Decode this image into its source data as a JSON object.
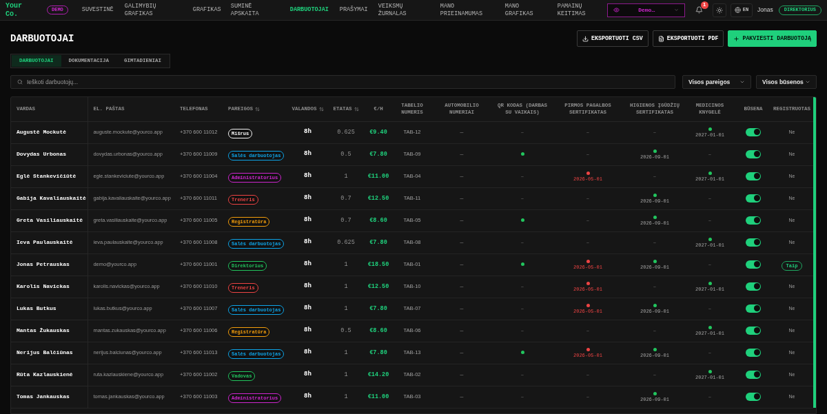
{
  "topbar": {
    "logo": "Your Co.",
    "env_badge": "DEMO",
    "nav": [
      {
        "label": "SUVESTINĖ",
        "selected": false
      },
      {
        "label": "GALIMYBIŲ GRAFIKAS",
        "selected": false
      },
      {
        "label": "GRAFIKAS",
        "selected": false
      },
      {
        "label": "SUMINĖ APSKAITA",
        "selected": false
      },
      {
        "label": "DARBUOTOJAI",
        "selected": true
      },
      {
        "label": "PRAŠYMAI",
        "selected": false
      },
      {
        "label": "VEIKSMŲ ŽURNALAS",
        "selected": false
      },
      {
        "label": "MANO PRIEINAMUMAS",
        "selected": false
      },
      {
        "label": "MANO GRAFIKAS",
        "selected": false
      },
      {
        "label": "PAMAINŲ KEITIMAS",
        "selected": false
      }
    ],
    "view_as": {
      "value": "Demo…"
    },
    "notifications": {
      "count": "1"
    },
    "language": "EN",
    "user": "Jonas",
    "role": "DIREKTORIUS"
  },
  "page": {
    "title": "DARBUOTOJAI",
    "actions": [
      {
        "kind": "download",
        "label": "EKSPORTUOTI CSV"
      },
      {
        "kind": "file",
        "label": "EKSPORTUOTI PDF"
      },
      {
        "kind": "primary",
        "label": "PAKVIESTI DARBUOTOJĄ"
      }
    ]
  },
  "tabs": [
    {
      "label": "DARBUOTOJAI",
      "selected": true
    },
    {
      "label": "DOKUMENTACIJA",
      "selected": false
    },
    {
      "label": "GIMTADIENIAI",
      "selected": false
    }
  ],
  "search": {
    "placeholder": "Ieškoti darbuotojų..."
  },
  "filters": [
    {
      "value": "Visos pareigos"
    },
    {
      "value": "Visos būsenos"
    }
  ],
  "table": {
    "columns": [
      {
        "label": "VARDAS",
        "sortable": false
      },
      {
        "label": "EL. PAŠTAS",
        "sortable": false
      },
      {
        "label": "TELEFONAS",
        "sortable": false
      },
      {
        "label": "PAREIGOS",
        "sortable": true
      },
      {
        "label": "VALANDOS",
        "sortable": true
      },
      {
        "label": "ETATAS",
        "sortable": true
      },
      {
        "label": "€/H",
        "sortable": false
      },
      {
        "label": "TABELIO NUMERIS",
        "sortable": false
      },
      {
        "label": "AUTOMOBILIO NUMERIAI",
        "sortable": false
      },
      {
        "label": "QR KODAS (DARBAS SU VAIKAIS)",
        "sortable": false
      },
      {
        "label": "PIRMOS PAGALBOS SERTIFIKATAS",
        "sortable": false
      },
      {
        "label": "HIGIENOS ĮGŪDŽIŲ SERTIFIKATAS",
        "sortable": false
      },
      {
        "label": "MEDICINOS KNYGELĖ",
        "sortable": false
      },
      {
        "label": "BŪSENA",
        "sortable": false
      },
      {
        "label": "REGISTRUOTAS",
        "sortable": false
      }
    ],
    "rows": [
      {
        "name": "Augustė Mockutė",
        "email": "auguste.mockute@yourco.app",
        "phone": "+370 600 11012",
        "role": {
          "label": "Mišrus",
          "color": "#f5f5f5"
        },
        "hours": "8h",
        "fte": "0.625",
        "rate": "€9.40",
        "tab_no": "TAB-12",
        "car": "—",
        "qr": {
          "kind": "dash",
          "text": "–"
        },
        "first_aid": {
          "kind": "dash",
          "text": "–"
        },
        "hygiene": {
          "kind": "dash",
          "text": "–"
        },
        "medical": {
          "kind": "date",
          "color": "#22c55e",
          "date": "2027-01-01",
          "expiring": false
        },
        "active": true,
        "registered": {
          "label": "Ne",
          "on": false
        }
      },
      {
        "name": "Dovydas Urbonas",
        "email": "dovydas.urbonas@yourco.app",
        "phone": "+370 600 11009",
        "role": {
          "label": "Salės darbuotojas",
          "color": "#0ea5e9"
        },
        "hours": "8h",
        "fte": "0.5",
        "rate": "€7.80",
        "tab_no": "TAB-09",
        "car": "—",
        "qr": {
          "kind": "dot",
          "color": "#22c55e"
        },
        "first_aid": {
          "kind": "dash",
          "text": "–"
        },
        "hygiene": {
          "kind": "date",
          "color": "#22c55e",
          "date": "2026-09-01",
          "expiring": false
        },
        "medical": {
          "kind": "dash",
          "text": "–"
        },
        "active": true,
        "registered": {
          "label": "Ne",
          "on": false
        }
      },
      {
        "name": "Eglė Stankevičiūtė",
        "email": "egle.stankeviciute@yourco.app",
        "phone": "+370 600 11004",
        "role": {
          "label": "Administratorius",
          "color": "#d026d0"
        },
        "hours": "8h",
        "fte": "1",
        "rate": "€11.00",
        "tab_no": "TAB-04",
        "car": "—",
        "qr": {
          "kind": "dash",
          "text": "–"
        },
        "first_aid": {
          "kind": "date",
          "color": "#ef4444",
          "date": "2026-05-01",
          "expiring": true
        },
        "hygiene": {
          "kind": "dash",
          "text": "–"
        },
        "medical": {
          "kind": "date",
          "color": "#22c55e",
          "date": "2027-01-01",
          "expiring": false
        },
        "active": true,
        "registered": {
          "label": "Ne",
          "on": false
        }
      },
      {
        "name": "Gabija Kavaliauskaitė",
        "email": "gabija.kavaliauskaite@yourco.app",
        "phone": "+370 600 11011",
        "role": {
          "label": "Treneris",
          "color": "#ef4444"
        },
        "hours": "8h",
        "fte": "0.7",
        "rate": "€12.50",
        "tab_no": "TAB-11",
        "car": "—",
        "qr": {
          "kind": "dash",
          "text": "–"
        },
        "first_aid": {
          "kind": "dash",
          "text": "–"
        },
        "hygiene": {
          "kind": "date",
          "color": "#22c55e",
          "date": "2026-09-01",
          "expiring": false
        },
        "medical": {
          "kind": "dash",
          "text": "–"
        },
        "active": true,
        "registered": {
          "label": "Ne",
          "on": false
        }
      },
      {
        "name": "Greta Vasiliauskaitė",
        "email": "greta.vasiliauskaite@yourco.app",
        "phone": "+370 600 11005",
        "role": {
          "label": "Registratūra",
          "color": "#f59e0b"
        },
        "hours": "8h",
        "fte": "0.7",
        "rate": "€8.60",
        "tab_no": "TAB-05",
        "car": "—",
        "qr": {
          "kind": "dot",
          "color": "#22c55e"
        },
        "first_aid": {
          "kind": "dash",
          "text": "–"
        },
        "hygiene": {
          "kind": "date",
          "color": "#22c55e",
          "date": "2026-09-01",
          "expiring": false
        },
        "medical": {
          "kind": "dash",
          "text": "–"
        },
        "active": true,
        "registered": {
          "label": "Ne",
          "on": false
        }
      },
      {
        "name": "Ieva Paulauskaitė",
        "email": "ieva.paulauskaite@yourco.app",
        "phone": "+370 600 11008",
        "role": {
          "label": "Salės darbuotojas",
          "color": "#0ea5e9"
        },
        "hours": "8h",
        "fte": "0.625",
        "rate": "€7.80",
        "tab_no": "TAB-08",
        "car": "—",
        "qr": {
          "kind": "dash",
          "text": "–"
        },
        "first_aid": {
          "kind": "dash",
          "text": "–"
        },
        "hygiene": {
          "kind": "dash",
          "text": "–"
        },
        "medical": {
          "kind": "date",
          "color": "#22c55e",
          "date": "2027-01-01",
          "expiring": false
        },
        "active": true,
        "registered": {
          "label": "Ne",
          "on": false
        }
      },
      {
        "name": "Jonas Petrauskas",
        "email": "demo@yourco.app",
        "phone": "+370 600 11001",
        "role": {
          "label": "Direktorius",
          "color": "#22c55e"
        },
        "hours": "8h",
        "fte": "1",
        "rate": "€18.50",
        "tab_no": "TAB-01",
        "car": "—",
        "qr": {
          "kind": "dot",
          "color": "#22c55e"
        },
        "first_aid": {
          "kind": "date",
          "color": "#ef4444",
          "date": "2026-05-01",
          "expiring": true
        },
        "hygiene": {
          "kind": "date",
          "color": "#22c55e",
          "date": "2026-09-01",
          "expiring": false
        },
        "medical": {
          "kind": "dash",
          "text": "–"
        },
        "active": true,
        "registered": {
          "label": "Taip",
          "on": true
        }
      },
      {
        "name": "Karolis Navickas",
        "email": "karolis.navickas@yourco.app",
        "phone": "+370 600 11010",
        "role": {
          "label": "Treneris",
          "color": "#ef4444"
        },
        "hours": "8h",
        "fte": "1",
        "rate": "€12.50",
        "tab_no": "TAB-10",
        "car": "—",
        "qr": {
          "kind": "dash",
          "text": "–"
        },
        "first_aid": {
          "kind": "date",
          "color": "#ef4444",
          "date": "2026-05-01",
          "expiring": true
        },
        "hygiene": {
          "kind": "dash",
          "text": "–"
        },
        "medical": {
          "kind": "date",
          "color": "#22c55e",
          "date": "2027-01-01",
          "expiring": false
        },
        "active": true,
        "registered": {
          "label": "Ne",
          "on": false
        }
      },
      {
        "name": "Lukas Butkus",
        "email": "lukas.butkus@yourco.app",
        "phone": "+370 600 11007",
        "role": {
          "label": "Salės darbuotojas",
          "color": "#0ea5e9"
        },
        "hours": "8h",
        "fte": "1",
        "rate": "€7.80",
        "tab_no": "TAB-07",
        "car": "—",
        "qr": {
          "kind": "dash",
          "text": "–"
        },
        "first_aid": {
          "kind": "date",
          "color": "#ef4444",
          "date": "2026-05-01",
          "expiring": true
        },
        "hygiene": {
          "kind": "date",
          "color": "#22c55e",
          "date": "2026-09-01",
          "expiring": false
        },
        "medical": {
          "kind": "dash",
          "text": "–"
        },
        "active": true,
        "registered": {
          "label": "Ne",
          "on": false
        }
      },
      {
        "name": "Mantas Žukauskas",
        "email": "mantas.zukauskas@yourco.app",
        "phone": "+370 600 11006",
        "role": {
          "label": "Registratūra",
          "color": "#f59e0b"
        },
        "hours": "8h",
        "fte": "0.5",
        "rate": "€8.60",
        "tab_no": "TAB-06",
        "car": "—",
        "qr": {
          "kind": "dash",
          "text": "–"
        },
        "first_aid": {
          "kind": "dash",
          "text": "–"
        },
        "hygiene": {
          "kind": "dash",
          "text": "–"
        },
        "medical": {
          "kind": "date",
          "color": "#22c55e",
          "date": "2027-01-01",
          "expiring": false
        },
        "active": true,
        "registered": {
          "label": "Ne",
          "on": false
        }
      },
      {
        "name": "Nerijus Balčiūnas",
        "email": "nerijus.balciunas@yourco.app",
        "phone": "+370 600 11013",
        "role": {
          "label": "Salės darbuotojas",
          "color": "#0ea5e9"
        },
        "hours": "8h",
        "fte": "1",
        "rate": "€7.80",
        "tab_no": "TAB-13",
        "car": "—",
        "qr": {
          "kind": "dot",
          "color": "#22c55e"
        },
        "first_aid": {
          "kind": "date",
          "color": "#ef4444",
          "date": "2026-05-01",
          "expiring": true
        },
        "hygiene": {
          "kind": "date",
          "color": "#22c55e",
          "date": "2026-09-01",
          "expiring": false
        },
        "medical": {
          "kind": "dash",
          "text": "–"
        },
        "active": true,
        "registered": {
          "label": "Ne",
          "on": false
        }
      },
      {
        "name": "Rūta Kazlauskienė",
        "email": "ruta.kazlauskiene@yourco.app",
        "phone": "+370 600 11002",
        "role": {
          "label": "Vadovas",
          "color": "#22c55e"
        },
        "hours": "8h",
        "fte": "1",
        "rate": "€14.20",
        "tab_no": "TAB-02",
        "car": "—",
        "qr": {
          "kind": "dash",
          "text": "–"
        },
        "first_aid": {
          "kind": "dash",
          "text": "–"
        },
        "hygiene": {
          "kind": "dash",
          "text": "–"
        },
        "medical": {
          "kind": "date",
          "color": "#22c55e",
          "date": "2027-01-01",
          "expiring": false
        },
        "active": true,
        "registered": {
          "label": "Ne",
          "on": false
        }
      },
      {
        "name": "Tomas Jankauskas",
        "email": "tomas.jankauskas@yourco.app",
        "phone": "+370 600 11003",
        "role": {
          "label": "Administratorius",
          "color": "#d026d0"
        },
        "hours": "8h",
        "fte": "1",
        "rate": "€11.00",
        "tab_no": "TAB-03",
        "car": "—",
        "qr": {
          "kind": "dash",
          "text": "–"
        },
        "first_aid": {
          "kind": "dash",
          "text": "–"
        },
        "hygiene": {
          "kind": "date",
          "color": "#22c55e",
          "date": "2026-09-01",
          "expiring": false
        },
        "medical": {
          "kind": "dash",
          "text": "–"
        },
        "active": true,
        "registered": {
          "label": "Ne",
          "on": false
        }
      }
    ]
  }
}
